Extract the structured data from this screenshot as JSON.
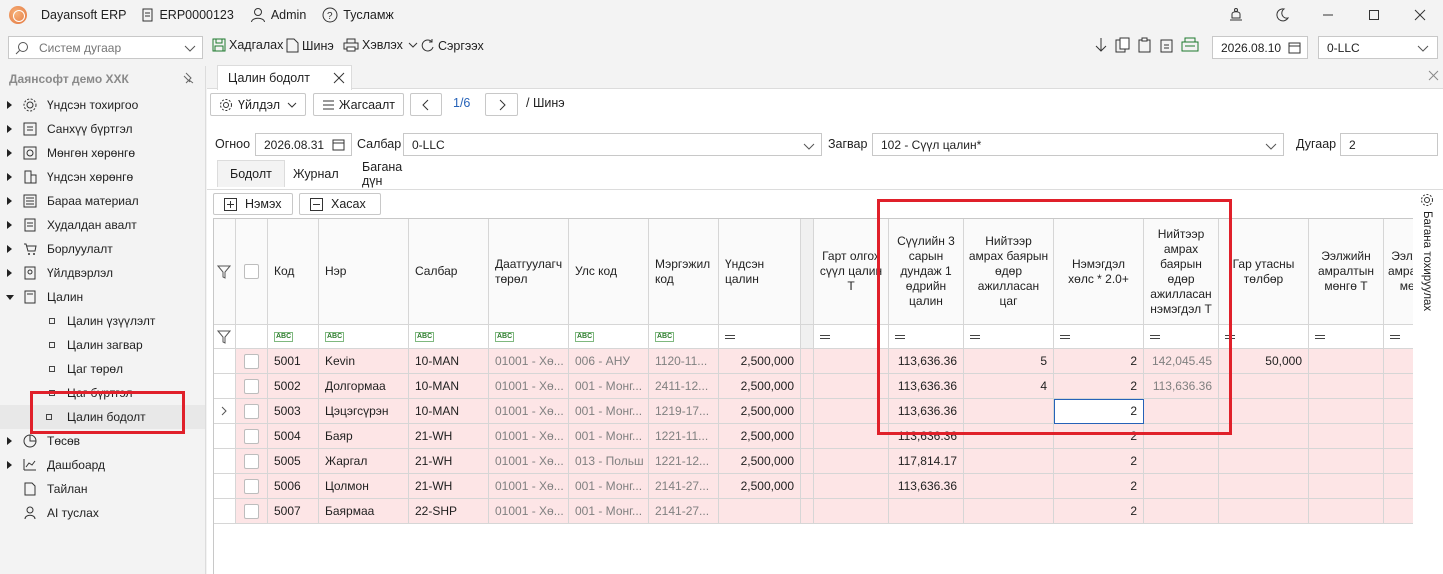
{
  "titlebar": {
    "app_name": "Dayansoft ERP",
    "document_no": "ERP0000123",
    "user": "Admin",
    "help": "Тусламж"
  },
  "toolbar": {
    "search_placeholder": "Систем дугаар",
    "save": "Хадгалах",
    "new": "Шинэ",
    "print": "Хэвлэх",
    "refresh": "Сэргээх",
    "date": "2026.08.10",
    "org": "0-LLC"
  },
  "sidebar": {
    "company": "Даянсофт демо ХХК",
    "items": [
      {
        "label": "Үндсэн тохиргоо"
      },
      {
        "label": "Санхүү бүртгэл"
      },
      {
        "label": "Мөнгөн хөрөнгө"
      },
      {
        "label": "Үндсэн хөрөнгө"
      },
      {
        "label": "Бараа материал"
      },
      {
        "label": "Худалдан авалт"
      },
      {
        "label": "Борлуулалт"
      },
      {
        "label": "Үйлдвэрлэл"
      },
      {
        "label": "Цалин"
      },
      {
        "label": "Төсөв"
      },
      {
        "label": "Дашбоард"
      },
      {
        "label": "Тайлан"
      },
      {
        "label": "AI туслах"
      }
    ],
    "sub_items": [
      {
        "label": "Цалин үзүүлэлт"
      },
      {
        "label": "Цалин загвар"
      },
      {
        "label": "Цаг төрөл"
      },
      {
        "label": "Цаг бүртгэл"
      },
      {
        "label": "Цалин бодолт"
      }
    ]
  },
  "main": {
    "tab_title": "Цалин бодолт",
    "actions_label": "Үйлдэл",
    "sort_label": "Жагсаалт",
    "pager": "1/6",
    "breadcrumb": "/ Шинэ",
    "form": {
      "date_label": "Огноо",
      "date_value": "2026.08.31",
      "branch_label": "Салбар",
      "branch_value": "0-LLC",
      "template_label": "Загвар",
      "template_value": "102 - Сүүл цалин*",
      "number_label": "Дугаар",
      "number_value": "2"
    },
    "subtabs": [
      "Бодолт",
      "Журнал",
      "Багана дүн"
    ],
    "add_button": "Нэмэх",
    "remove_button": "Хасах",
    "side_tab": "Багана тохируулах"
  },
  "grid": {
    "columns": [
      "Код",
      "Нэр",
      "Салбар",
      "Даатгуулагч төрөл",
      "Улс код",
      "Мэргэжил код",
      "Үндсэн цалин",
      "Гарт олгох сүүл цалин Т",
      "Сүүлийн 3 сарын дундаж 1 өдрийн цалин",
      "Нийтээр амрах баярын өдөр ажилласан цаг",
      "Нэмэгдэл хөлс * 2.0+",
      "Нийтээр амрах баярын өдөр ажилласан нэмэгдэл Т",
      "Гар утасны төлбөр",
      "Ээлжийн амралтын мөнгө Т",
      "Ээлжийн амралтын мөнгө"
    ],
    "rows": [
      {
        "code": "5001",
        "name": "Kevin",
        "branch": "10-MAN",
        "ins": "01001 - Хө...",
        "country": "006 - АНУ",
        "prof": "1120-11...",
        "base": "2,500,000",
        "avg": "113,636.36",
        "hours": "5",
        "mult": "2",
        "holiday": "142,045.45",
        "phone": "50,000"
      },
      {
        "code": "5002",
        "name": "Долгормаа",
        "branch": "10-MAN",
        "ins": "01001 - Хө...",
        "country": "001 - Монг...",
        "prof": "2411-12...",
        "base": "2,500,000",
        "avg": "113,636.36",
        "hours": "4",
        "mult": "2",
        "holiday": "113,636.36",
        "phone": ""
      },
      {
        "code": "5003",
        "name": "Цэцэгсүрэн",
        "branch": "10-MAN",
        "ins": "01001 - Хө...",
        "country": "001 - Монг...",
        "prof": "1219-17...",
        "base": "2,500,000",
        "avg": "113,636.36",
        "hours": "",
        "mult": "2",
        "holiday": "",
        "phone": ""
      },
      {
        "code": "5004",
        "name": "Баяр",
        "branch": "21-WH",
        "ins": "01001 - Хө...",
        "country": "001 - Монг...",
        "prof": "1221-11...",
        "base": "2,500,000",
        "avg": "113,636.36",
        "hours": "",
        "mult": "2",
        "holiday": "",
        "phone": ""
      },
      {
        "code": "5005",
        "name": "Жаргал",
        "branch": "21-WH",
        "ins": "01001 - Хө...",
        "country": "013 - Польш",
        "prof": "1221-12...",
        "base": "2,500,000",
        "avg": "117,814.17",
        "hours": "",
        "mult": "2",
        "holiday": "",
        "phone": ""
      },
      {
        "code": "5006",
        "name": "Цолмон",
        "branch": "21-WH",
        "ins": "01001 - Хө...",
        "country": "001 - Монг...",
        "prof": "2141-27...",
        "base": "2,500,000",
        "avg": "113,636.36",
        "hours": "",
        "mult": "2",
        "holiday": "",
        "phone": ""
      },
      {
        "code": "5007",
        "name": "Баярмаа",
        "branch": "22-SHP",
        "ins": "01001 - Хө...",
        "country": "001 - Монг...",
        "prof": "2141-27...",
        "base": "",
        "avg": "",
        "hours": "",
        "mult": "2",
        "holiday": "",
        "phone": ""
      }
    ]
  },
  "colors": {
    "row_bg": "#fde5e6",
    "highlight_red": "#e0202a",
    "link_blue": "#2662b8"
  }
}
